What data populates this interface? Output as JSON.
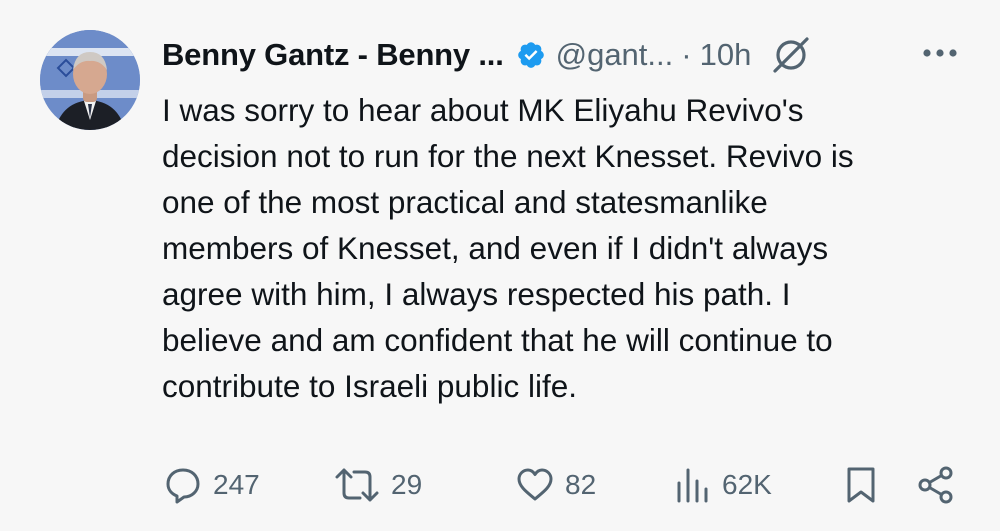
{
  "author": {
    "display_name": "Benny Gantz - Benny ...",
    "handle": "@gant...",
    "separator": "·",
    "time": "10h"
  },
  "tweet": {
    "text": "I was sorry to hear about MK Eliyahu Revivo's\ndecision not to run for the next Knesset. Revivo is\none of the most practical and statesmanlike\nmembers of Knesset, and even if I didn't always\nagree with him, I always respected his path. I\nbelieve and am confident that he will continue to\ncontribute to Israeli public life."
  },
  "actions": {
    "replies": "247",
    "reposts": "29",
    "likes": "82",
    "views": "62K"
  },
  "icons": {
    "verified": "verified-badge-icon",
    "grok": "grok-icon",
    "more": "more-icon",
    "reply": "reply-icon",
    "repost": "repost-icon",
    "like": "heart-icon",
    "views": "views-icon",
    "bookmark": "bookmark-icon",
    "share": "share-icon"
  },
  "colors": {
    "text": "#0f1419",
    "secondary": "#536471",
    "verified": "#1d9bf0",
    "background": "#f7f7f7"
  }
}
